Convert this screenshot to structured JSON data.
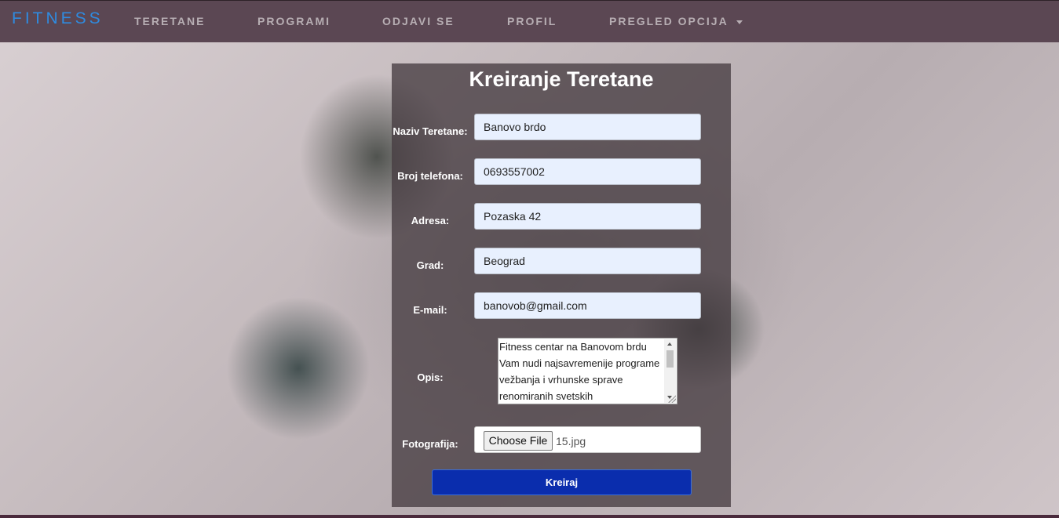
{
  "navbar": {
    "brand": "FITNESS",
    "items": [
      {
        "label": "TERETANE"
      },
      {
        "label": "PROGRAMI"
      },
      {
        "label": "ODJAVI SE"
      },
      {
        "label": "PROFIL"
      },
      {
        "label": "PREGLED OPCIJA"
      }
    ]
  },
  "form": {
    "title": "Kreiranje Teretane",
    "fields": {
      "naziv": {
        "label": "Naziv Teretane:",
        "value": "Banovo brdo"
      },
      "telefon": {
        "label": "Broj telefona:",
        "value": "0693557002"
      },
      "adresa": {
        "label": "Adresa:",
        "value": "Pozaska 42"
      },
      "grad": {
        "label": "Grad:",
        "value": "Beograd"
      },
      "email": {
        "label": "E-mail:",
        "value": "banovob@gmail.com"
      },
      "opis": {
        "label": "Opis:",
        "value": "Fitness centar na Banovom brdu Vam nudi najsavremenije programe vežbanja i vrhunske sprave renomiranih svetskih"
      },
      "fotografija": {
        "label": "Fotografija:",
        "button": "Choose File",
        "filename": "15.jpg"
      }
    },
    "submit_label": "Kreiraj"
  },
  "colors": {
    "navbar_bg": "#5b4753",
    "brand": "#2f8be0",
    "submit_bg": "#0a2dad",
    "input_bg": "#e8f0fe"
  }
}
